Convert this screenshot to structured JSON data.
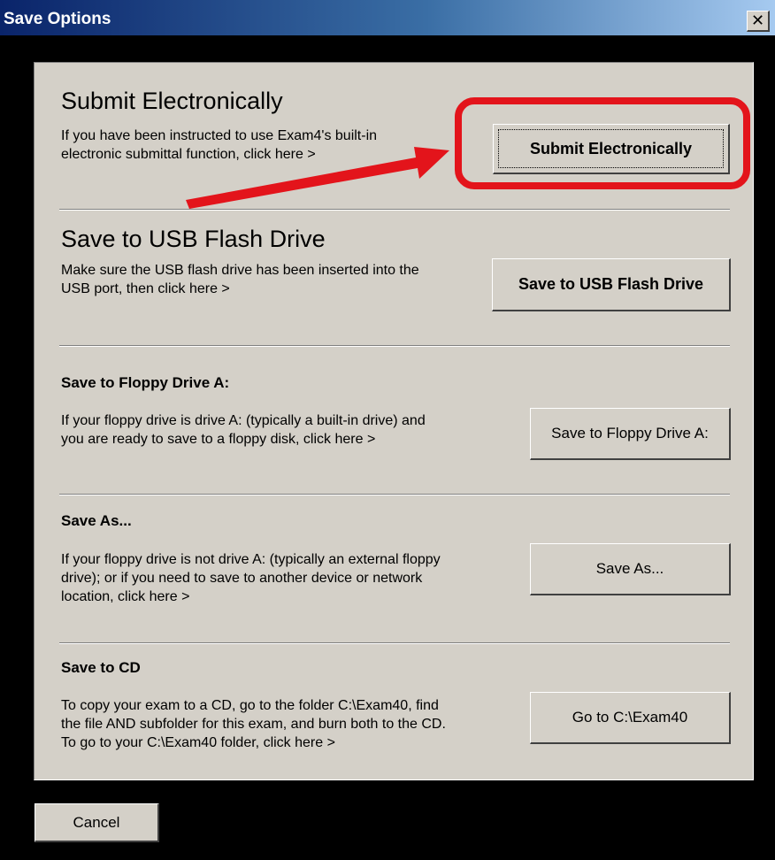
{
  "window": {
    "title": "Save Options",
    "close_glyph": "✕"
  },
  "sections": {
    "submit": {
      "heading": "Submit Electronically",
      "desc_1": "If you have been instructed to use Exam4's built-in",
      "desc_2": "electronic submittal function, click here >",
      "button": "Submit Electronically"
    },
    "usb": {
      "heading": "Save to USB Flash Drive",
      "desc_1": "Make sure the USB flash drive has been inserted into the",
      "desc_2": "USB port, then click here >",
      "button": "Save to USB Flash Drive"
    },
    "floppy": {
      "heading": "Save to Floppy Drive A:",
      "desc_1": "If your floppy drive is drive A: (typically a built-in drive) and",
      "desc_2": "you are ready to save to a floppy disk, click here >",
      "button": "Save to Floppy Drive A:"
    },
    "saveas": {
      "heading": "Save As...",
      "desc_1": "If your floppy drive is not drive A: (typically an external floppy",
      "desc_2": "drive); or if you need to save to another device or network",
      "desc_3": "location, click here >",
      "button": "Save As..."
    },
    "cd": {
      "heading": "Save to CD",
      "desc_1": "To copy your exam to a CD, go to the folder C:\\Exam40, find",
      "desc_2": "the file AND subfolder for this exam, and burn both to the CD.",
      "desc_3": "To go to your C:\\Exam40 folder, click here >",
      "button": "Go to C:\\Exam40"
    }
  },
  "footer": {
    "cancel": "Cancel"
  },
  "colors": {
    "annotation": "#e3141b",
    "dialog_face": "#d4d0c8",
    "title_bar": "#0a246a"
  }
}
